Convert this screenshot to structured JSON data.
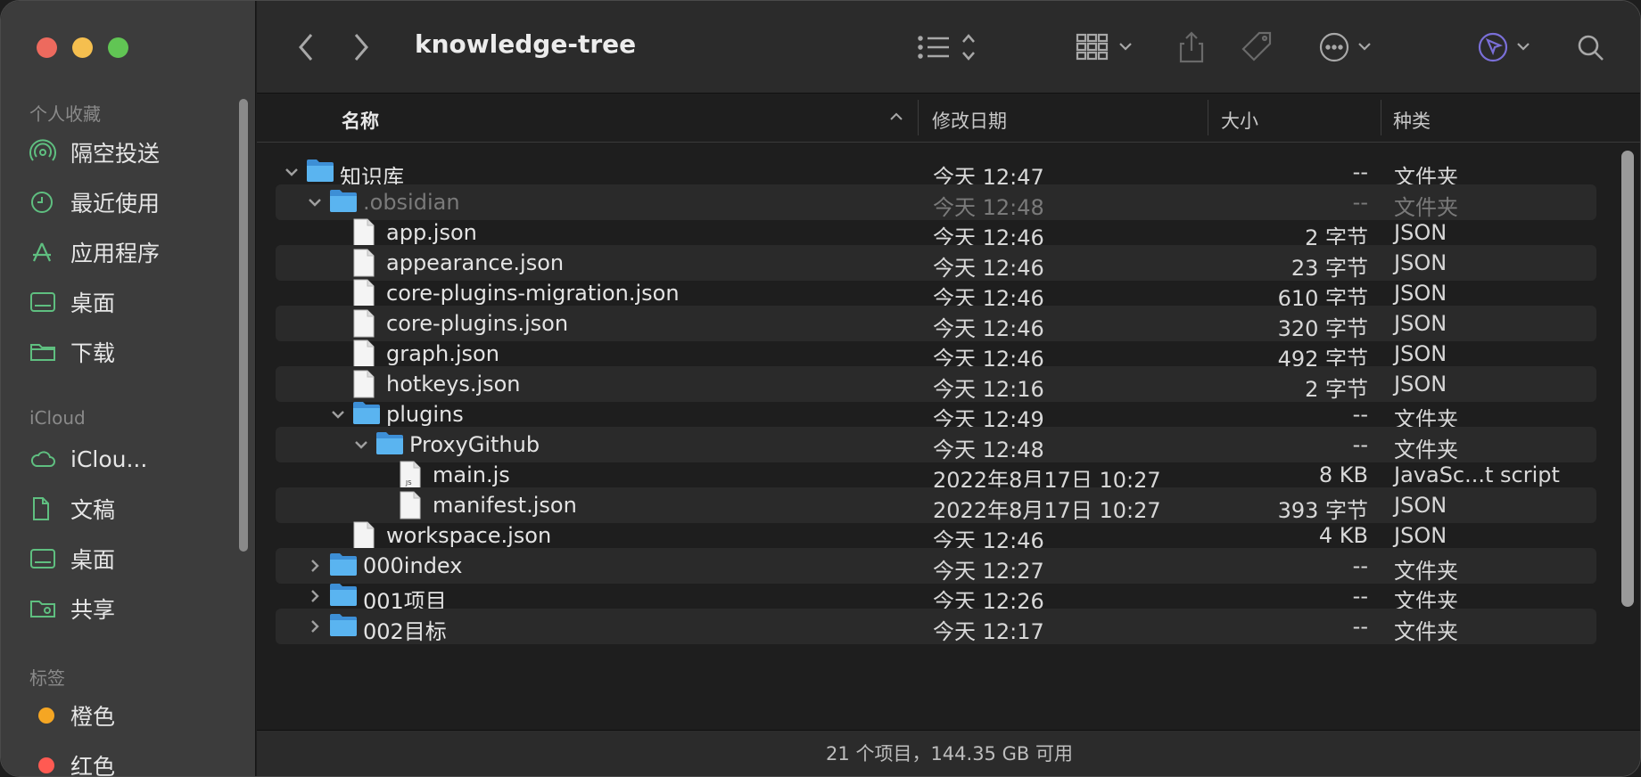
{
  "window": {
    "title": "knowledge-tree"
  },
  "sidebar": {
    "favorites_heading": "个人收藏",
    "favorites": [
      {
        "label": "隔空投送",
        "icon": "airdrop-icon"
      },
      {
        "label": "最近使用",
        "icon": "clock-icon"
      },
      {
        "label": "应用程序",
        "icon": "applications-icon"
      },
      {
        "label": "桌面",
        "icon": "desktop-icon"
      },
      {
        "label": "下载",
        "icon": "folder-icon"
      }
    ],
    "icloud_heading": "iCloud",
    "icloud": [
      {
        "label": "iClou...",
        "icon": "cloud-icon"
      },
      {
        "label": "文稿",
        "icon": "document-icon"
      },
      {
        "label": "桌面",
        "icon": "desktop-icon"
      },
      {
        "label": "共享",
        "icon": "shared-folder-icon"
      }
    ],
    "tags_heading": "标签",
    "tags": [
      {
        "label": "橙色",
        "color": "#f5a623"
      },
      {
        "label": "红色",
        "color": "#ff5a52"
      }
    ]
  },
  "columns": {
    "name": "名称",
    "date": "修改日期",
    "size": "大小",
    "kind": "种类"
  },
  "files": [
    {
      "name": "知识库",
      "date": "今天 12:47",
      "size": "--",
      "kind": "文件夹",
      "type": "folder",
      "level": 0,
      "expanded": true
    },
    {
      "name": ".obsidian",
      "date": "今天 12:48",
      "size": "--",
      "kind": "文件夹",
      "type": "folder",
      "level": 1,
      "expanded": true,
      "dim": true
    },
    {
      "name": "app.json",
      "date": "今天 12:46",
      "size": "2 字节",
      "kind": "JSON",
      "type": "file",
      "level": 2
    },
    {
      "name": "appearance.json",
      "date": "今天 12:46",
      "size": "23 字节",
      "kind": "JSON",
      "type": "file",
      "level": 2
    },
    {
      "name": "core-plugins-migration.json",
      "date": "今天 12:46",
      "size": "610 字节",
      "kind": "JSON",
      "type": "file",
      "level": 2
    },
    {
      "name": "core-plugins.json",
      "date": "今天 12:46",
      "size": "320 字节",
      "kind": "JSON",
      "type": "file",
      "level": 2
    },
    {
      "name": "graph.json",
      "date": "今天 12:46",
      "size": "492 字节",
      "kind": "JSON",
      "type": "file",
      "level": 2
    },
    {
      "name": "hotkeys.json",
      "date": "今天 12:16",
      "size": "2 字节",
      "kind": "JSON",
      "type": "file",
      "level": 2
    },
    {
      "name": "plugins",
      "date": "今天 12:49",
      "size": "--",
      "kind": "文件夹",
      "type": "folder",
      "level": 2,
      "expanded": true
    },
    {
      "name": "ProxyGithub",
      "date": "今天 12:48",
      "size": "--",
      "kind": "文件夹",
      "type": "folder",
      "level": 3,
      "expanded": true
    },
    {
      "name": "main.js",
      "date": "2022年8月17日 10:27",
      "size": "8 KB",
      "kind": "JavaSc...t script",
      "type": "js",
      "level": 4
    },
    {
      "name": "manifest.json",
      "date": "2022年8月17日 10:27",
      "size": "393 字节",
      "kind": "JSON",
      "type": "file",
      "level": 4
    },
    {
      "name": "workspace.json",
      "date": "今天 12:46",
      "size": "4 KB",
      "kind": "JSON",
      "type": "file",
      "level": 2
    },
    {
      "name": "000index",
      "date": "今天 12:27",
      "size": "--",
      "kind": "文件夹",
      "type": "folder",
      "level": 1,
      "expanded": false
    },
    {
      "name": "001项目",
      "date": "今天 12:26",
      "size": "--",
      "kind": "文件夹",
      "type": "folder",
      "level": 1,
      "expanded": false
    },
    {
      "name": "002目标",
      "date": "今天 12:17",
      "size": "--",
      "kind": "文件夹",
      "type": "folder",
      "level": 1,
      "expanded": false
    }
  ],
  "status": "21 个项目，144.35 GB 可用",
  "colors": {
    "folder": "#5ab4f0",
    "accent_green": "#5fbf80"
  }
}
